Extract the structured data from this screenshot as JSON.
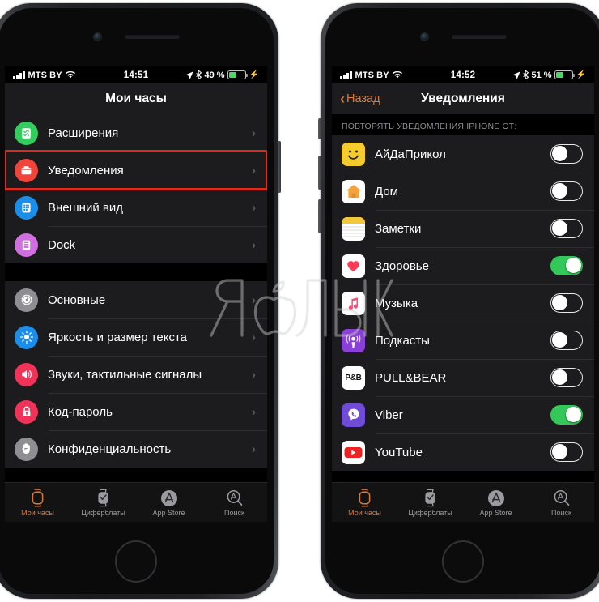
{
  "meta": {
    "watermark_text": "ЯБЛЫК",
    "accent_orange": "#d9793c",
    "toggle_on_green": "#34c759",
    "highlight_red": "#e02a1b",
    "background": "#ffffff"
  },
  "left_phone": {
    "status_bar": {
      "carrier": "MTS BY",
      "time": "14:51",
      "battery_percent": "49 %",
      "signal_icon": "signal-bars-icon",
      "wifi_icon": "wifi-icon",
      "location_icon": "location-arrow-icon",
      "bluetooth_icon": "bluetooth-icon",
      "battery_icon": "battery-icon",
      "charging_icon": "charging-bolt-icon"
    },
    "navbar": {
      "title": "Мои часы"
    },
    "group_one": [
      {
        "label": "Расширения",
        "icon": "extensions-icon",
        "chevron": "›"
      },
      {
        "label": "Уведомления",
        "icon": "notifications-icon",
        "chevron": "›",
        "highlighted": true
      },
      {
        "label": "Внешний вид",
        "icon": "appearance-icon",
        "chevron": "›"
      },
      {
        "label": "Dock",
        "icon": "dock-icon",
        "chevron": "›"
      }
    ],
    "group_two": [
      {
        "label": "Основные",
        "icon": "general-gear-icon",
        "chevron": "›"
      },
      {
        "label": "Яркость и размер текста",
        "icon": "brightness-icon",
        "chevron": "›"
      },
      {
        "label": "Звуки, тактильные сигналы",
        "icon": "sounds-icon",
        "chevron": "›"
      },
      {
        "label": "Код-пароль",
        "icon": "passcode-lock-icon",
        "chevron": "›"
      },
      {
        "label": "Конфиденциальность",
        "icon": "privacy-hand-icon",
        "chevron": "›"
      }
    ],
    "tabbar": [
      {
        "label": "Мои часы",
        "icon": "watch-icon",
        "active": true
      },
      {
        "label": "Циферблаты",
        "icon": "watchface-icon",
        "active": false
      },
      {
        "label": "App Store",
        "icon": "appstore-icon",
        "active": false
      },
      {
        "label": "Поиск",
        "icon": "search-icon",
        "active": false
      }
    ]
  },
  "right_phone": {
    "status_bar": {
      "carrier": "MTS BY",
      "time": "14:52",
      "battery_percent": "51 %",
      "signal_icon": "signal-bars-icon",
      "wifi_icon": "wifi-icon",
      "location_icon": "location-arrow-icon",
      "bluetooth_icon": "bluetooth-icon",
      "battery_icon": "battery-icon",
      "charging_icon": "charging-bolt-icon"
    },
    "navbar": {
      "back_label": "Назад",
      "back_chevron": "‹",
      "title": "Уведомления"
    },
    "section_header": "ПОВТОРЯТЬ УВЕДОМЛЕНИЯ IPHONE ОТ:",
    "apps": [
      {
        "label": "АйДаПрикол",
        "icon": "aydaprikol-app-icon",
        "enabled": false
      },
      {
        "label": "Дом",
        "icon": "home-app-icon",
        "enabled": false
      },
      {
        "label": "Заметки",
        "icon": "notes-app-icon",
        "enabled": false
      },
      {
        "label": "Здоровье",
        "icon": "health-app-icon",
        "enabled": true
      },
      {
        "label": "Музыка",
        "icon": "music-app-icon",
        "enabled": false
      },
      {
        "label": "Подкасты",
        "icon": "podcasts-app-icon",
        "enabled": false
      },
      {
        "label": "PULL&BEAR",
        "icon": "pullandbear-app-icon",
        "enabled": false
      },
      {
        "label": "Viber",
        "icon": "viber-app-icon",
        "enabled": true
      },
      {
        "label": "YouTube",
        "icon": "youtube-app-icon",
        "enabled": false
      }
    ],
    "tabbar": [
      {
        "label": "Мои часы",
        "icon": "watch-icon",
        "active": true
      },
      {
        "label": "Циферблаты",
        "icon": "watchface-icon",
        "active": false
      },
      {
        "label": "App Store",
        "icon": "appstore-icon",
        "active": false
      },
      {
        "label": "Поиск",
        "icon": "search-icon",
        "active": false
      }
    ]
  }
}
